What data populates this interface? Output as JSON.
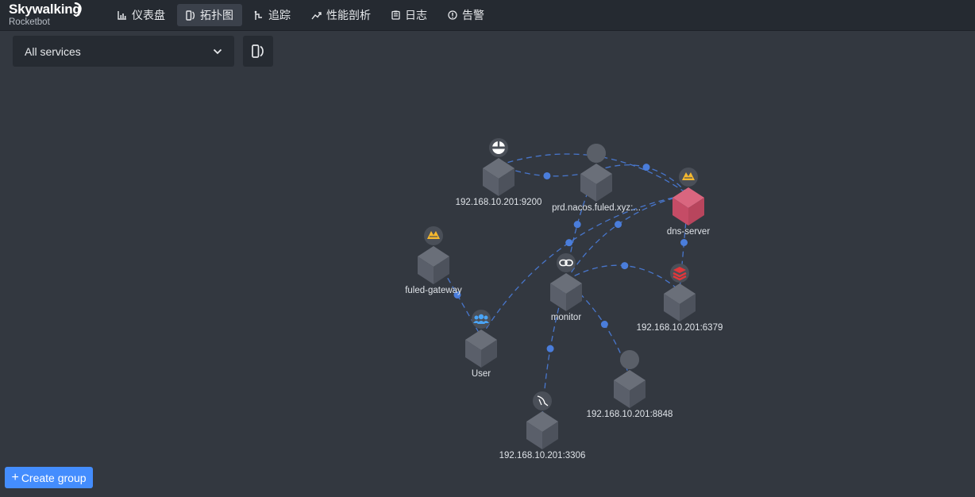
{
  "app": {
    "logo": "Skywalking",
    "subtitle": "Rocketbot"
  },
  "nav": [
    {
      "label": "仪表盘",
      "icon": "bar-chart-icon",
      "active": false
    },
    {
      "label": "拓扑图",
      "icon": "topology-icon",
      "active": true
    },
    {
      "label": "追踪",
      "icon": "trace-icon",
      "active": false
    },
    {
      "label": "性能剖析",
      "icon": "trend-icon",
      "active": false
    },
    {
      "label": "日志",
      "icon": "log-icon",
      "active": false
    },
    {
      "label": "告警",
      "icon": "alert-icon",
      "active": false
    }
  ],
  "toolbar": {
    "service_select": "All services"
  },
  "create_group": "Create group",
  "colors": {
    "accent": "#448dfe",
    "edge": "#4a7ddb",
    "cube": "#5a5f6a",
    "dns_cube": "#c54c66"
  },
  "topology": {
    "nodes": [
      {
        "id": "es",
        "label": "192.168.10.201:9200",
        "icon": "elasticsearch-icon"
      },
      {
        "id": "nacos",
        "label": "prd.nacos.fuled.xyz:...",
        "icon": "unknown-icon"
      },
      {
        "id": "dns",
        "label": "dns-server",
        "icon": "tomcat-icon"
      },
      {
        "id": "gateway",
        "label": "fuled-gateway",
        "icon": "tomcat-icon"
      },
      {
        "id": "monitor",
        "label": "monitor",
        "icon": "link-icon"
      },
      {
        "id": "redis",
        "label": "192.168.10.201:6379",
        "icon": "redis-icon"
      },
      {
        "id": "user",
        "label": "User",
        "icon": "user-group-icon"
      },
      {
        "id": "nacos2",
        "label": "192.168.10.201:8848",
        "icon": "unknown-icon"
      },
      {
        "id": "mysql",
        "label": "192.168.10.201:3306",
        "icon": "mysql-icon"
      }
    ],
    "edges": [
      {
        "from": "es",
        "to": "dns"
      },
      {
        "from": "nacos",
        "to": "dns"
      },
      {
        "from": "user",
        "to": "dns"
      },
      {
        "from": "monitor",
        "to": "dns"
      },
      {
        "from": "dns",
        "to": "redis"
      },
      {
        "from": "gateway",
        "to": "user"
      },
      {
        "from": "monitor",
        "to": "nacos"
      },
      {
        "from": "monitor",
        "to": "redis"
      },
      {
        "from": "monitor",
        "to": "mysql"
      },
      {
        "from": "monitor",
        "to": "nacos2"
      },
      {
        "from": "nacos",
        "to": "es"
      }
    ]
  }
}
